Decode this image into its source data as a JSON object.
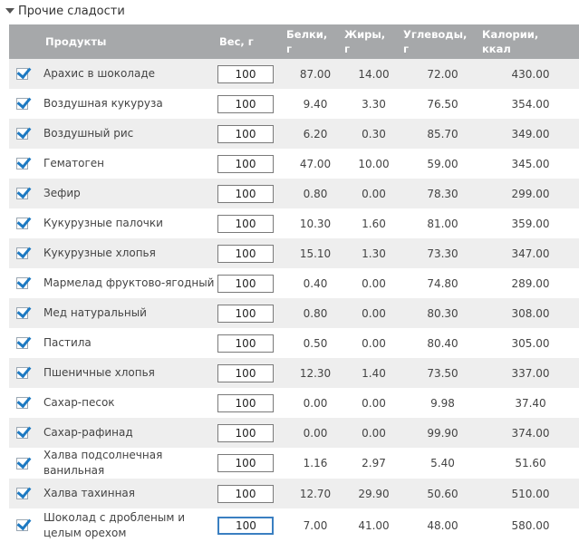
{
  "section": {
    "title": "Прочие сладости"
  },
  "columns": {
    "product": "Продукты",
    "weight": "Вес, г",
    "protein_1": "Белки,",
    "protein_2": "г",
    "fat_1": "Жиры,",
    "fat_2": "г",
    "carbs_1": "Углеводы,",
    "carbs_2": "г",
    "cal_1": "Калории,",
    "cal_2": "ккал"
  },
  "rows": [
    {
      "checked": true,
      "name": "Арахис в шоколаде",
      "weight": "100",
      "protein": "87.00",
      "fat": "14.00",
      "carbs": "72.00",
      "calories": "430.00"
    },
    {
      "checked": true,
      "name": "Воздушная кукуруза",
      "weight": "100",
      "protein": "9.40",
      "fat": "3.30",
      "carbs": "76.50",
      "calories": "354.00"
    },
    {
      "checked": true,
      "name": "Воздушный рис",
      "weight": "100",
      "protein": "6.20",
      "fat": "0.30",
      "carbs": "85.70",
      "calories": "349.00"
    },
    {
      "checked": true,
      "name": "Гематоген",
      "weight": "100",
      "protein": "47.00",
      "fat": "10.00",
      "carbs": "59.00",
      "calories": "345.00"
    },
    {
      "checked": true,
      "name": "Зефир",
      "weight": "100",
      "protein": "0.80",
      "fat": "0.00",
      "carbs": "78.30",
      "calories": "299.00"
    },
    {
      "checked": true,
      "name": "Кукурузные палочки",
      "weight": "100",
      "protein": "10.30",
      "fat": "1.60",
      "carbs": "81.00",
      "calories": "359.00"
    },
    {
      "checked": true,
      "name": "Кукурузные хлопья",
      "weight": "100",
      "protein": "15.10",
      "fat": "1.30",
      "carbs": "73.30",
      "calories": "347.00"
    },
    {
      "checked": true,
      "name": "Мармелад фруктово-ягодный",
      "weight": "100",
      "protein": "0.40",
      "fat": "0.00",
      "carbs": "74.80",
      "calories": "289.00"
    },
    {
      "checked": true,
      "name": "Мед натуральный",
      "weight": "100",
      "protein": "0.80",
      "fat": "0.00",
      "carbs": "80.30",
      "calories": "308.00"
    },
    {
      "checked": true,
      "name": "Пастила",
      "weight": "100",
      "protein": "0.50",
      "fat": "0.00",
      "carbs": "80.40",
      "calories": "305.00"
    },
    {
      "checked": true,
      "name": "Пшеничные хлопья",
      "weight": "100",
      "protein": "12.30",
      "fat": "1.40",
      "carbs": "73.50",
      "calories": "337.00"
    },
    {
      "checked": true,
      "name": "Сахар-песок",
      "weight": "100",
      "protein": "0.00",
      "fat": "0.00",
      "carbs": "9.98",
      "calories": "37.40"
    },
    {
      "checked": true,
      "name": "Сахар-рафинад",
      "weight": "100",
      "protein": "0.00",
      "fat": "0.00",
      "carbs": "99.90",
      "calories": "374.00"
    },
    {
      "checked": true,
      "name": "Халва подсолнечная ванильная",
      "weight": "100",
      "protein": "1.16",
      "fat": "2.97",
      "carbs": "5.40",
      "calories": "51.60"
    },
    {
      "checked": true,
      "name": "Халва тахинная",
      "weight": "100",
      "protein": "12.70",
      "fat": "29.90",
      "carbs": "50.60",
      "calories": "510.00"
    },
    {
      "checked": true,
      "name": "Шоколад с дробленым и целым орехом",
      "weight": "100",
      "protein": "7.00",
      "fat": "41.00",
      "carbs": "48.00",
      "calories": "580.00"
    }
  ]
}
